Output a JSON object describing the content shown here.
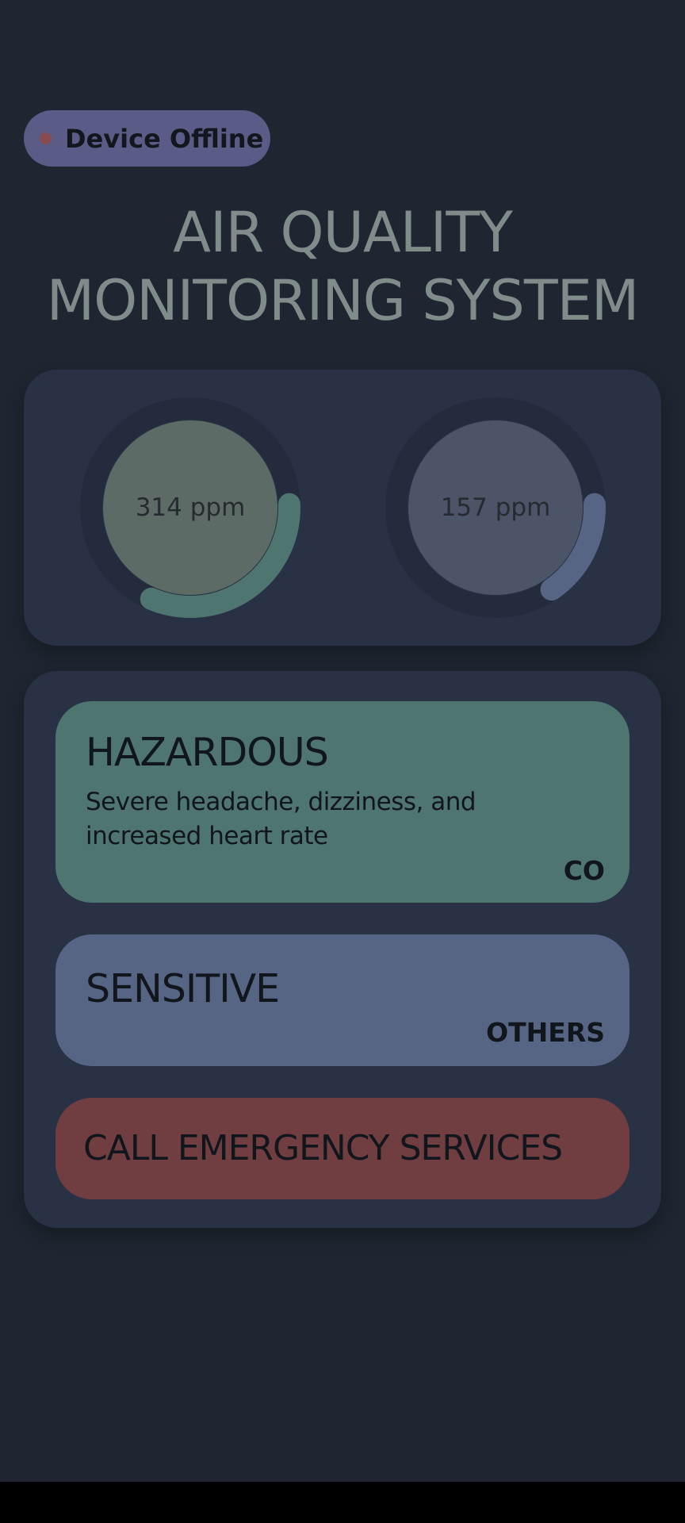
{
  "status": {
    "label": "Device Offline",
    "dot_color": "#8a4a52",
    "pill_color": "#5a5b86"
  },
  "title": {
    "line1": "AIR QUALITY",
    "line2": "MONITORING SYSTEM"
  },
  "gauges": [
    {
      "value_label": "314 ppm",
      "fill_fraction": 0.32,
      "arc_color": "#4f7570",
      "core_color": "#5d6b66"
    },
    {
      "value_label": "157 ppm",
      "fill_fraction": 0.16,
      "arc_color": "#576584",
      "core_color": "#4c5467"
    }
  ],
  "cards": {
    "hazardous": {
      "title": "HAZARDOUS",
      "description": "Severe headache, dizziness, and increased heart rate",
      "tag": "CO",
      "color": "#4f7570"
    },
    "sensitive": {
      "title": "SENSITIVE",
      "tag": "OTHERS",
      "color": "#576584"
    },
    "emergency": {
      "label": "CALL EMERGENCY SERVICES",
      "color": "#703e40"
    }
  }
}
